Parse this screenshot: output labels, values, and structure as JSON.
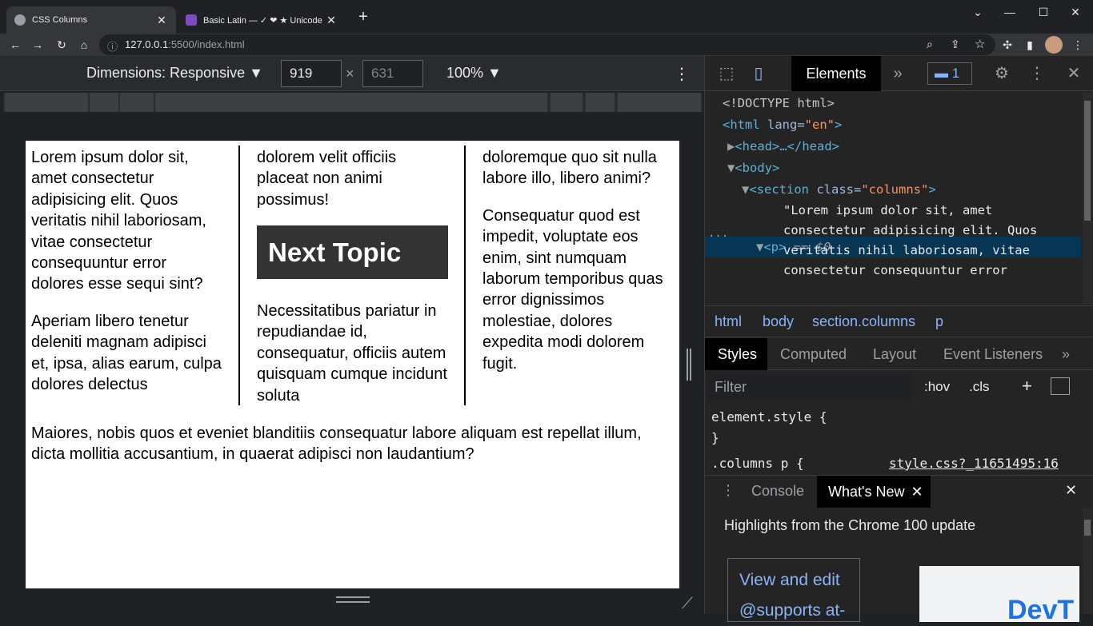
{
  "browser": {
    "tabs": [
      {
        "title": "CSS Columns",
        "active": true,
        "close": "✕"
      },
      {
        "title": "Basic Latin — ✓ ❤ ★ Unicode",
        "active": false,
        "close": "✕"
      }
    ],
    "new_tab": "+",
    "window_controls": {
      "dropdown": "⌄",
      "minimize": "—",
      "maximize": "☐",
      "close": "✕"
    },
    "url_host": "127.0.0.1",
    "url_rest": ":5500/index.html"
  },
  "device_toolbar": {
    "dimensions_label": "Dimensions: Responsive ▼",
    "width": "919",
    "times": "×",
    "height": "631",
    "zoom": "100% ▼",
    "more": "⋮"
  },
  "page": {
    "col1_p1": "Lorem ipsum dolor sit, amet consectetur adipisicing elit. Quos veritatis nihil laboriosam, vitae consectetur consequuntur error dolores esse sequi sint?",
    "col1_p2": "Aperiam libero tenetur deleniti magnam adipisci et, ipsa, alias earum, culpa dolores delectus",
    "col2_p1": "dolorem velit officiis placeat non animi possimus!",
    "next_topic": "Next Topic",
    "col2_p2": "Necessitatibus pariatur in repudiandae id, consequatur, officiis autem quisquam cumque incidunt soluta",
    "col3_p1": "doloremque quo sit nulla labore illo, libero animi?",
    "col3_p2": "Consequatur quod est impedit, voluptate eos enim, sint numquam laborum temporibus quas error dignissimos molestiae, dolores expedita modi dolorem fugit.",
    "tail": "Maiores, nobis quos et eveniet blanditiis consequatur labore aliquam est repellat illum, dicta mollitia accusantium, in quaerat adipisci non laudantium?"
  },
  "devtools": {
    "elements_tab": "Elements",
    "more_tabs": "»",
    "issues_count": "1",
    "dom": {
      "doctype": "<!DOCTYPE html>",
      "html_open": "<html",
      "html_attr": " lang=",
      "html_val": "\"en\"",
      "html_close": ">",
      "head": "<head>…</head>",
      "body": "<body>",
      "section_open": "<section",
      "section_attr": " class=",
      "section_val": "\"columns\"",
      "section_close": ">",
      "p_node": "<p>",
      "p_eq": " == $0",
      "text_1": "\"Lorem ipsum dolor sit, amet",
      "text_2": "consectetur adipisicing elit. Quos",
      "text_3": "veritatis nihil laboriosam, vitae",
      "text_4": "consectetur consequuntur error"
    },
    "breadcrumbs": [
      "html",
      "body",
      "section.columns",
      "p"
    ],
    "styles_tabs": [
      "Styles",
      "Computed",
      "Layout",
      "Event Listeners"
    ],
    "filter_placeholder": "Filter",
    "hov": ":hov",
    "cls": ".cls",
    "plus": "+",
    "element_style": "element.style {",
    "close_brace": "}",
    "rule_selector": ".columns p {",
    "rule_source": "style.css?_11651495:16",
    "drawer_tabs": {
      "console": "Console",
      "whats_new": "What's New"
    },
    "highlights": "Highlights from the Chrome 100 update",
    "card_text": "View and edit @supports at-",
    "promo_text": "DevT"
  },
  "colors": {
    "accent_blue": "#8ab4f8",
    "selection": "#073655",
    "tag": "#5db0d7",
    "attr_value": "#f29766"
  }
}
